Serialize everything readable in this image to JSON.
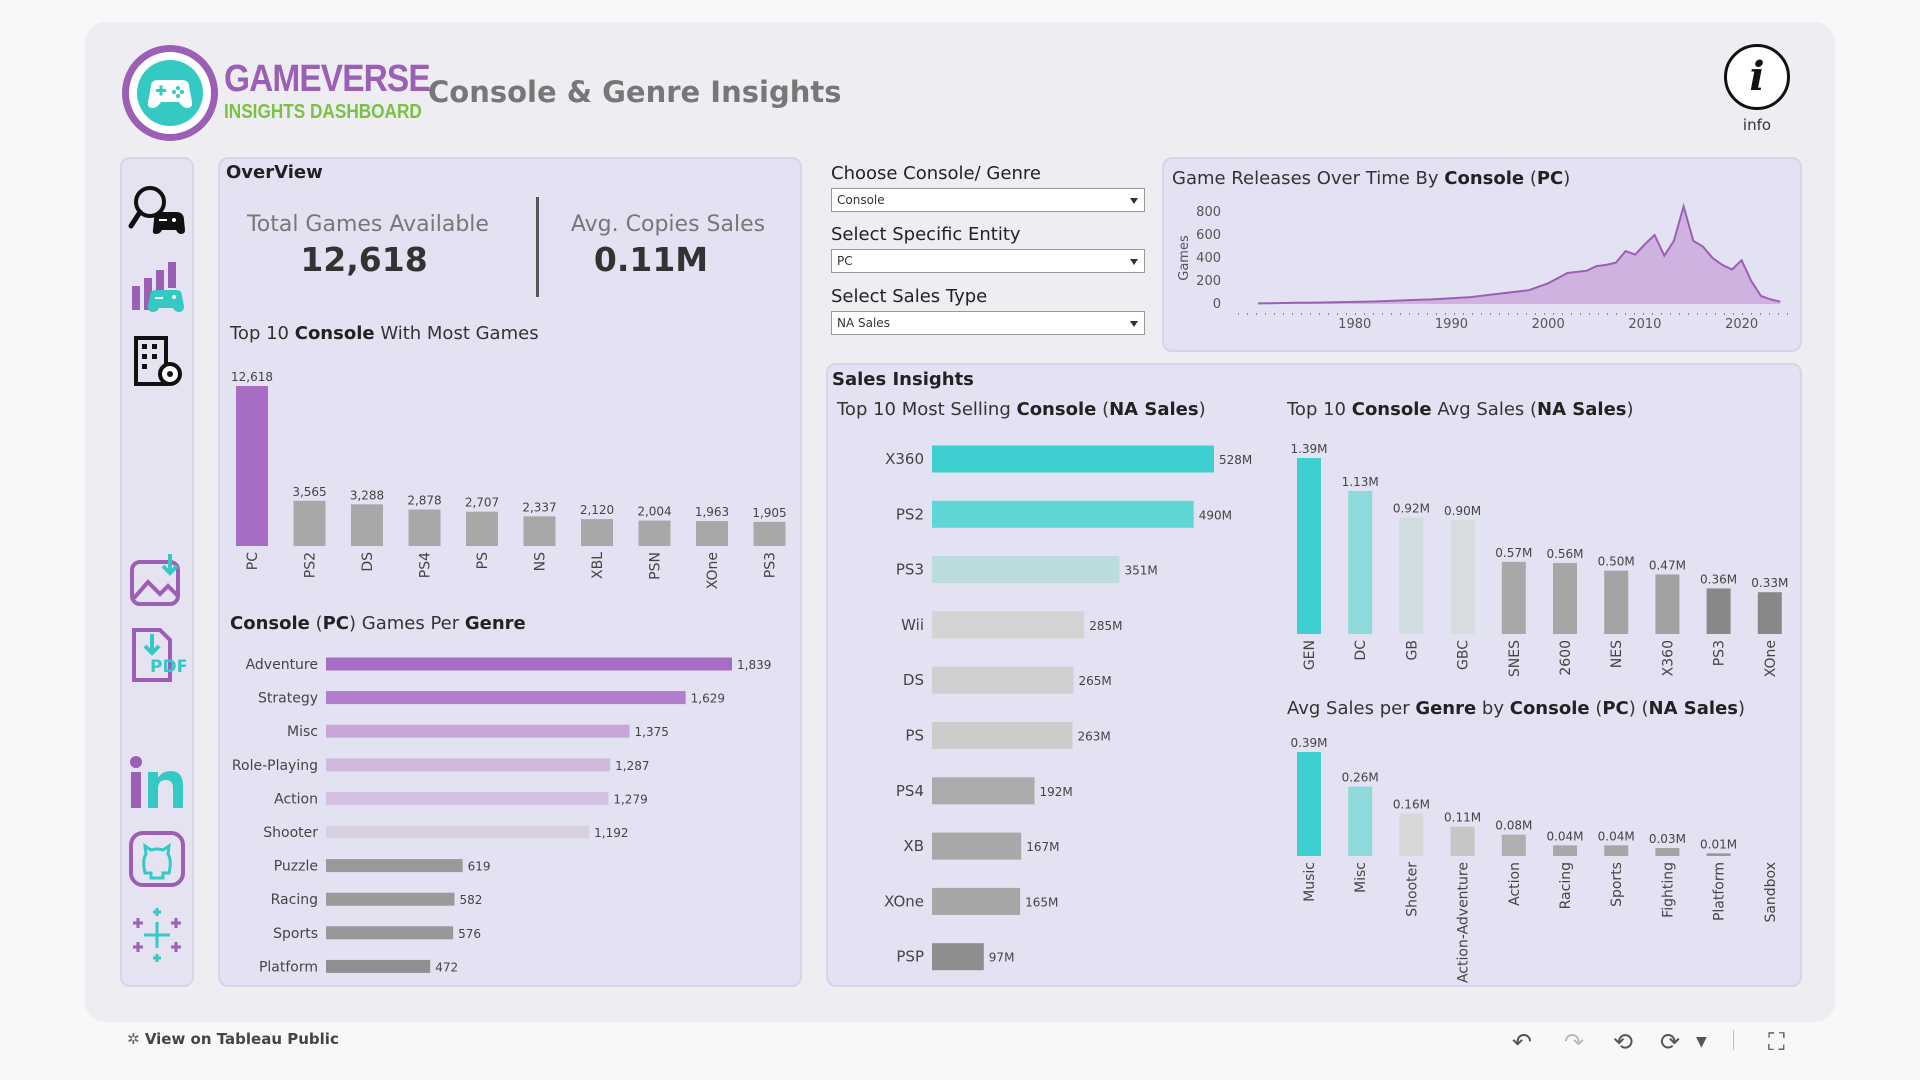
{
  "header": {
    "brand_line1": "GAMEVERSE",
    "brand_line2": "INSIGHTS DASHBOARD",
    "title": "Console & Genre Insights",
    "info_label": "info"
  },
  "sidebar": {
    "items": [
      {
        "name": "explore-icon"
      },
      {
        "name": "console-stats-icon"
      },
      {
        "name": "settings-building-icon"
      },
      {
        "name": "download-image-icon"
      },
      {
        "name": "download-pdf-icon"
      },
      {
        "name": "linkedin-icon"
      },
      {
        "name": "github-icon"
      },
      {
        "name": "tableau-icon"
      }
    ]
  },
  "overview": {
    "heading": "OverView",
    "kpi1_label": "Total Games Available",
    "kpi1_value": "12,618",
    "kpi2_label": "Avg. Copies Sales",
    "kpi2_value": "0.11M"
  },
  "controls": {
    "c1_label": "Choose Console/ Genre",
    "c1_value": "Console",
    "c2_label": "Select Specific Entity",
    "c2_value": "PC",
    "c3_label": "Select Sales Type",
    "c3_value": "NA Sales"
  },
  "sales_heading": "Sales Insights",
  "titles": {
    "top_console_pre": "Top 10 ",
    "top_console_bold": "Console",
    "top_console_post": " With Most Games",
    "genre_pre1": "Console",
    "genre_mid": " (",
    "genre_bold2": "PC",
    "genre_mid2": ") Games Per ",
    "genre_bold3": "Genre",
    "release_pre": "Game Releases Over Time By ",
    "release_bold": "Console",
    "release_mid": " (",
    "release_bold2": "PC",
    "release_post": ")",
    "selling_pre": "Top 10 Most Selling ",
    "selling_bold": "Console",
    "selling_mid": " (",
    "selling_bold2": "NA Sales",
    "selling_post": ")",
    "avg_pre": "Top 10 ",
    "avg_bold": "Console",
    "avg_mid": " Avg Sales (",
    "avg_bold2": "NA Sales",
    "avg_post": ")",
    "genre_avg_pre": "Avg Sales per ",
    "genre_avg_bold": "Genre",
    "genre_avg_mid": " by ",
    "genre_avg_bold2": "Console",
    "genre_avg_mid2": " (",
    "genre_avg_bold3": "PC",
    "genre_avg_mid3": ") (",
    "genre_avg_bold4": "NA Sales",
    "genre_avg_post": ")"
  },
  "footer": {
    "link": "View on Tableau Public"
  },
  "colors": {
    "purple": "#a76cc4",
    "light_purple": "#c8a6d8",
    "teal": "#3ecfd0",
    "gray": "#a8a8a8",
    "dark_gray": "#8a8a8a"
  },
  "chart_data": [
    {
      "id": "top_console_games",
      "type": "bar",
      "categories": [
        "PC",
        "PS2",
        "DS",
        "PS4",
        "PS",
        "NS",
        "XBL",
        "PSN",
        "XOne",
        "PS3"
      ],
      "values": [
        12618,
        3565,
        3288,
        2878,
        2707,
        2337,
        2120,
        2004,
        1963,
        1905
      ],
      "labels": [
        "12,618",
        "3,565",
        "3,288",
        "2,878",
        "2,707",
        "2,337",
        "2,120",
        "2,004",
        "1,963",
        "1,905"
      ]
    },
    {
      "id": "genre_counts",
      "type": "bar",
      "orientation": "horizontal",
      "categories": [
        "Adventure",
        "Strategy",
        "Misc",
        "Role-Playing",
        "Action",
        "Shooter",
        "Puzzle",
        "Racing",
        "Sports",
        "Platform"
      ],
      "values": [
        1839,
        1629,
        1375,
        1287,
        1279,
        1192,
        619,
        582,
        576,
        472
      ],
      "labels": [
        "1,839",
        "1,629",
        "1,375",
        "1,287",
        "1,279",
        "1,192",
        "619",
        "582",
        "576",
        "472"
      ]
    },
    {
      "id": "releases_over_time",
      "type": "area",
      "ylabel": "Games",
      "ylim": [
        0,
        800
      ],
      "yticks": [
        "0",
        "200",
        "400",
        "600",
        "800"
      ],
      "xticks": [
        "1980",
        "1990",
        "2000",
        "2010",
        "2020"
      ],
      "x": [
        1970,
        1972,
        1974,
        1976,
        1978,
        1980,
        1982,
        1984,
        1986,
        1988,
        1990,
        1992,
        1994,
        1996,
        1998,
        2000,
        2002,
        2004,
        2005,
        2006,
        2007,
        2008,
        2009,
        2010,
        2011,
        2012,
        2013,
        2014,
        2015,
        2016,
        2017,
        2018,
        2019,
        2020,
        2021,
        2022,
        2023,
        2024
      ],
      "y": [
        5,
        8,
        10,
        12,
        15,
        18,
        22,
        28,
        35,
        40,
        50,
        60,
        80,
        100,
        120,
        180,
        270,
        290,
        330,
        340,
        360,
        460,
        430,
        520,
        600,
        420,
        550,
        850,
        550,
        500,
        400,
        340,
        300,
        380,
        200,
        70,
        40,
        20
      ]
    },
    {
      "id": "top_selling_console",
      "type": "bar",
      "orientation": "horizontal",
      "categories": [
        "X360",
        "PS2",
        "PS3",
        "Wii",
        "DS",
        "PS",
        "PS4",
        "XB",
        "XOne",
        "PSP"
      ],
      "values": [
        528,
        490,
        351,
        285,
        265,
        263,
        192,
        167,
        165,
        97
      ],
      "labels": [
        "528M",
        "490M",
        "351M",
        "285M",
        "265M",
        "263M",
        "192M",
        "167M",
        "165M",
        "97M"
      ],
      "unit": "M"
    },
    {
      "id": "console_avg_sales",
      "type": "bar",
      "categories": [
        "GEN",
        "DC",
        "GB",
        "GBC",
        "SNES",
        "2600",
        "NES",
        "X360",
        "PS3",
        "XOne"
      ],
      "values": [
        1.39,
        1.13,
        0.92,
        0.9,
        0.57,
        0.56,
        0.5,
        0.47,
        0.36,
        0.33
      ],
      "labels": [
        "1.39M",
        "1.13M",
        "0.92M",
        "0.90M",
        "0.57M",
        "0.56M",
        "0.50M",
        "0.47M",
        "0.36M",
        "0.33M"
      ]
    },
    {
      "id": "genre_avg_sales",
      "type": "bar",
      "categories": [
        "Music",
        "Misc",
        "Shooter",
        "Action-Adventure",
        "Action",
        "Racing",
        "Sports",
        "Fighting",
        "Platform",
        "Sandbox"
      ],
      "values": [
        0.39,
        0.26,
        0.16,
        0.11,
        0.08,
        0.04,
        0.04,
        0.03,
        0.01,
        0
      ],
      "labels": [
        "0.39M",
        "0.26M",
        "0.16M",
        "0.11M",
        "0.08M",
        "0.04M",
        "0.04M",
        "0.03M",
        "0.01M",
        ""
      ]
    }
  ]
}
